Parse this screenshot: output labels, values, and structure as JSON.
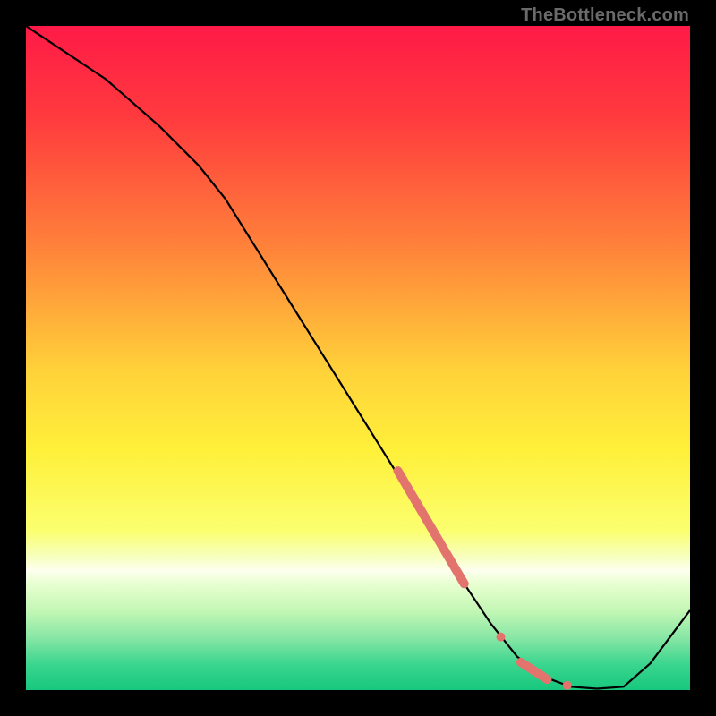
{
  "watermark": "TheBottleneck.com",
  "chart_data": {
    "type": "line",
    "title": "",
    "xlabel": "",
    "ylabel": "",
    "xlim": [
      0,
      100
    ],
    "ylim": [
      0,
      100
    ],
    "grid": false,
    "gradient_stops": [
      {
        "offset": 0,
        "color": "#ff1a47"
      },
      {
        "offset": 14,
        "color": "#ff3b3e"
      },
      {
        "offset": 33,
        "color": "#ff813a"
      },
      {
        "offset": 52,
        "color": "#ffd23a"
      },
      {
        "offset": 64,
        "color": "#fff03a"
      },
      {
        "offset": 76,
        "color": "#fbff6f"
      },
      {
        "offset": 80,
        "color": "#f7ffc0"
      },
      {
        "offset": 82,
        "color": "#fdffef"
      },
      {
        "offset": 84,
        "color": "#e8ffd0"
      },
      {
        "offset": 88,
        "color": "#c4f7b5"
      },
      {
        "offset": 92,
        "color": "#8ae7a6"
      },
      {
        "offset": 96,
        "color": "#3cd68f"
      },
      {
        "offset": 100,
        "color": "#17c77d"
      }
    ],
    "series": [
      {
        "name": "bottleneck-curve",
        "color": "#000000",
        "x": [
          0,
          6,
          12,
          20,
          26,
          30,
          40,
          50,
          60,
          66,
          70,
          74,
          78,
          82,
          86,
          90,
          94,
          100
        ],
        "y": [
          100,
          96,
          92,
          85,
          79,
          74,
          58,
          42,
          26,
          16,
          10,
          5,
          2,
          0.5,
          0.2,
          0.5,
          4,
          12
        ]
      }
    ],
    "highlights": [
      {
        "name": "thick-region",
        "type": "line-segment",
        "color": "#e2736d",
        "width": 10,
        "x": [
          56,
          66
        ],
        "y": [
          33,
          16
        ]
      },
      {
        "name": "dot-1",
        "type": "point",
        "color": "#e2736d",
        "r": 5,
        "x": 71.5,
        "y": 8
      },
      {
        "name": "thick-region-2",
        "type": "line-segment",
        "color": "#e2736d",
        "width": 10,
        "x": [
          74.5,
          78.5
        ],
        "y": [
          4.2,
          1.6
        ]
      },
      {
        "name": "dot-2",
        "type": "point",
        "color": "#e2736d",
        "r": 5,
        "x": 81.5,
        "y": 0.7
      }
    ]
  }
}
